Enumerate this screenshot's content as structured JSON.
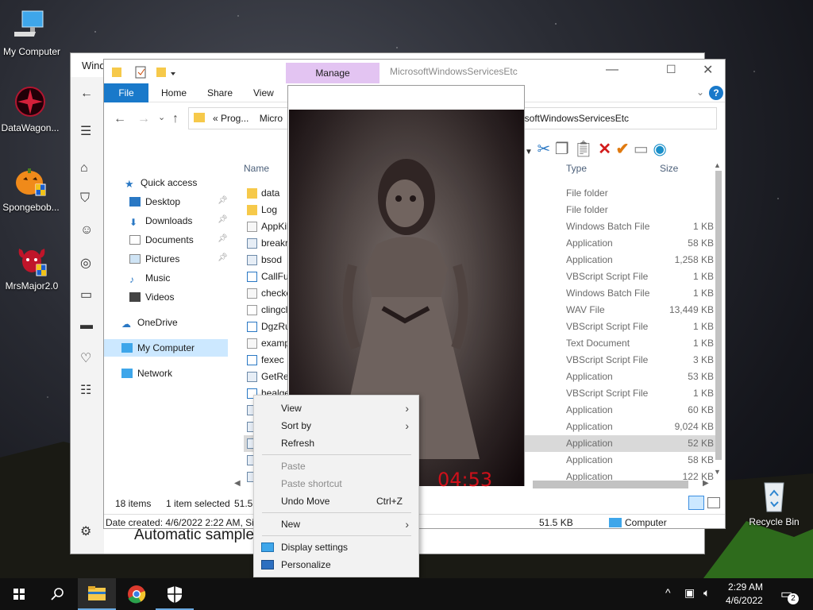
{
  "desktop": {
    "icons": [
      {
        "label": "My Computer"
      },
      {
        "label": "DataWagon..."
      },
      {
        "label": "Spongebob..."
      },
      {
        "label": "MrsMajor2.0"
      },
      {
        "label": "Recycle Bin"
      }
    ]
  },
  "background_window": {
    "title": "Wind",
    "bottom_text": "Automatic sample"
  },
  "explorer": {
    "manage_tab": "Manage",
    "window_title": "MicrosoftWindowsServicesEtc",
    "ribbon_tabs": [
      "File",
      "Home",
      "Share",
      "View"
    ],
    "address_left": "« Prog...",
    "address_mid": "Micro",
    "address_right": "rosoftWindowsServicesEtc",
    "columns": {
      "name": "Name",
      "type": "Type",
      "size": "Size"
    },
    "nav": {
      "quick_access": "Quick access",
      "desktop": "Desktop",
      "downloads": "Downloads",
      "documents": "Documents",
      "pictures": "Pictures",
      "music": "Music",
      "videos": "Videos",
      "onedrive": "OneDrive",
      "my_computer": "My Computer",
      "network": "Network"
    },
    "files": [
      {
        "name": "data",
        "type": "File folder",
        "size": ""
      },
      {
        "name": "Log",
        "type": "File folder",
        "size": ""
      },
      {
        "name": "AppKil",
        "type": "Windows Batch File",
        "size": "1 KB"
      },
      {
        "name": "breakr",
        "type": "Application",
        "size": "58 KB"
      },
      {
        "name": "bsod",
        "type": "Application",
        "size": "1,258 KB"
      },
      {
        "name": "CallFu",
        "type": "VBScript Script File",
        "size": "1 KB"
      },
      {
        "name": "checke",
        "type": "Windows Batch File",
        "size": "1 KB"
      },
      {
        "name": "clingcl",
        "type": "WAV File",
        "size": "13,449 KB"
      },
      {
        "name": "DgzRu",
        "type": "VBScript Script File",
        "size": "1 KB"
      },
      {
        "name": "examp",
        "type": "Text Document",
        "size": "1 KB"
      },
      {
        "name": "fexec",
        "type": "VBScript Script File",
        "size": "3 KB"
      },
      {
        "name": "GetRea",
        "type": "Application",
        "size": "53 KB"
      },
      {
        "name": "healge",
        "type": "VBScript Script File",
        "size": "1 KB"
      },
      {
        "name": "",
        "type": "Application",
        "size": "60 KB"
      },
      {
        "name": "",
        "type": "Application",
        "size": "9,024 KB"
      },
      {
        "name": "",
        "type": "Application",
        "size": "52 KB"
      },
      {
        "name": "",
        "type": "Application",
        "size": "58 KB"
      },
      {
        "name": "",
        "type": "Application",
        "size": "122 KB"
      }
    ],
    "status": {
      "items": "18 items",
      "selected": "1 item selected",
      "selected_size": "51.5"
    },
    "details": {
      "created": "Date created: 4/6/2022 2:22 AM, Size",
      "size": "51.5 KB",
      "location": "Computer"
    }
  },
  "video": {
    "timer": "04:53"
  },
  "context_menu": {
    "view": "View",
    "sort_by": "Sort by",
    "refresh": "Refresh",
    "paste": "Paste",
    "paste_shortcut": "Paste shortcut",
    "undo_move": "Undo Move",
    "undo_shortcut": "Ctrl+Z",
    "new": "New",
    "display_settings": "Display settings",
    "personalize": "Personalize"
  },
  "taskbar": {
    "time": "2:29 AM",
    "date": "4/6/2022",
    "notification_count": "2"
  }
}
